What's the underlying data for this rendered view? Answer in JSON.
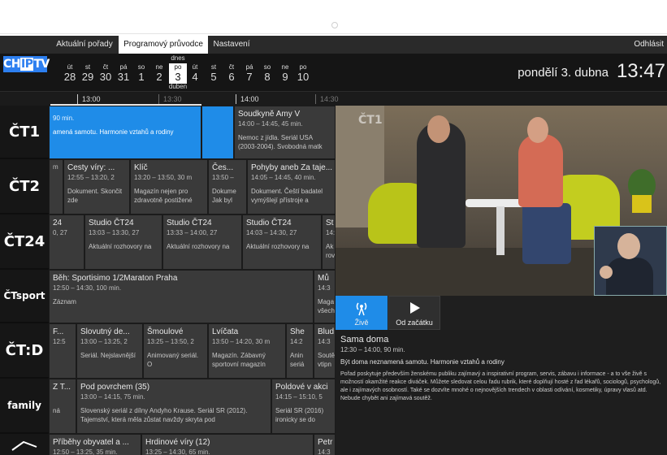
{
  "nav": {
    "tabs": [
      "Aktuální pořady",
      "Programový průvodce",
      "Nastavení"
    ],
    "logout": "Odhlásit"
  },
  "header": {
    "logo": "CHIPTV",
    "today_top": "dnes",
    "today_bottom": "duben",
    "days": [
      {
        "name": "út",
        "num": "28"
      },
      {
        "name": "st",
        "num": "29"
      },
      {
        "name": "čt",
        "num": "30"
      },
      {
        "name": "pá",
        "num": "31"
      },
      {
        "name": "so",
        "num": "1"
      },
      {
        "name": "ne",
        "num": "2"
      },
      {
        "name": "po",
        "num": "3"
      },
      {
        "name": "út",
        "num": "4"
      },
      {
        "name": "st",
        "num": "5"
      },
      {
        "name": "čt",
        "num": "6"
      },
      {
        "name": "pá",
        "num": "7"
      },
      {
        "name": "so",
        "num": "8"
      },
      {
        "name": "ne",
        "num": "9"
      },
      {
        "name": "po",
        "num": "10"
      }
    ],
    "date": "pondělí 3. dubna",
    "time": "13:47"
  },
  "timeline": [
    "13:00",
    "13:30",
    "14:00",
    "14:30"
  ],
  "channels": [
    {
      "name": "ČT1",
      "programs": [
        {
          "title": "",
          "time": "90 min.",
          "desc": "amená samotu. Harmonie vztahů a rodiny"
        },
        {
          "title": "",
          "time": "",
          "desc": ""
        },
        {
          "title": "Soudkyně Amy V",
          "time": "14:00 – 14:45, 45 min.",
          "desc": "Nemoc z jídla. Seriál USA (2003-2004). Svobodná matk"
        }
      ]
    },
    {
      "name": "ČT2",
      "programs": [
        {
          "title": "",
          "time": "m",
          "desc": ""
        },
        {
          "title": "Cesty víry: ...",
          "time": "12:55 – 13:20, 2",
          "desc": "Dokument. Skončit zde"
        },
        {
          "title": "Klíč",
          "time": "13:20 – 13:50, 30 m",
          "desc": "Magazín nejen pro zdravotně postižené"
        },
        {
          "title": "Čes...",
          "time": "13:50 –",
          "desc": "Dokume Jak byl"
        },
        {
          "title": "Pohyby aneb Za taje...",
          "time": "14:05 – 14:45, 40 min.",
          "desc": "Dokument. Čeští badatel vymýšlejí přístroje a"
        }
      ]
    },
    {
      "name": "ČT24",
      "programs": [
        {
          "title": "24",
          "time": "0, 27",
          "desc": ""
        },
        {
          "title": "Studio ČT24",
          "time": "13:03 – 13:30, 27",
          "desc": "Aktuální rozhovory na"
        },
        {
          "title": "Studio ČT24",
          "time": "13:33 – 14:00, 27",
          "desc": "Aktuální rozhovory na"
        },
        {
          "title": "Studio ČT24",
          "time": "14:03 – 14:30, 27",
          "desc": "Aktuální rozhovory na"
        },
        {
          "title": "St",
          "time": "14:",
          "desc": "Ak rov"
        }
      ]
    },
    {
      "name": "ČTsport",
      "programs": [
        {
          "title": "Běh: Sportisimo 1/2Maraton Praha",
          "time": "12:50 – 14:30, 100 min.",
          "desc": "Záznam"
        },
        {
          "title": "Mů",
          "time": "14:3",
          "desc": "Maga všech"
        }
      ]
    },
    {
      "name": "ČT:D",
      "programs": [
        {
          "title": "F...",
          "time": "12:5",
          "desc": ""
        },
        {
          "title": "Slovutný de...",
          "time": "13:00 – 13:25, 2",
          "desc": "Seriál. Nejslavnější"
        },
        {
          "title": "Šmoulové",
          "time": "13:25 – 13:50, 2",
          "desc": "Animovaný seriál. O"
        },
        {
          "title": "Lvíčata",
          "time": "13:50 – 14:20, 30 m",
          "desc": "Magazín. Zábavný sportovní magazín"
        },
        {
          "title": "She",
          "time": "14:2",
          "desc": "Anin seriá"
        },
        {
          "title": "Blud",
          "time": "14:3",
          "desc": "Soutě vtipn"
        }
      ]
    },
    {
      "name": "family",
      "programs": [
        {
          "title": "Z T...",
          "time": "",
          "desc": "ná"
        },
        {
          "title": "Pod povrchem (35)",
          "time": "13:00 – 14:15, 75 min.",
          "desc": "Slovenský seriál z dílny Andyho Krause. Seriál SR (2012). Tajemství, která měla zůstat navždy skryta pod"
        },
        {
          "title": "Poldové v akci",
          "time": "14:15 – 15:10, 5",
          "desc": "Seriál SR (2016) ironicky se do"
        }
      ]
    },
    {
      "name": "",
      "programs": [
        {
          "title": "Příběhy obyvatel a ...",
          "time": "12:50 – 13:25, 35 min.",
          "desc": ""
        },
        {
          "title": "Hrdinové víry (12)",
          "time": "13:25 – 14:30, 65 min.",
          "desc": ""
        },
        {
          "title": "Petr",
          "time": "14:3",
          "desc": ""
        }
      ]
    }
  ],
  "player": {
    "watermark": "ČT1",
    "live_label": "Živě",
    "restart_label": "Od začátku"
  },
  "detail": {
    "title": "Sama doma",
    "time": "12:30 – 14:00, 90 min.",
    "short": "Být doma neznamená samotu. Harmonie vztahů a rodiny",
    "long": "Pořad poskytuje především ženskému publiku zajímavý a inspirativní program, servis, zábavu i informace - a to vše živě s možností okamžité reakce diváček. Můžete sledovat celou řadu rubrik, které doplňují hosté z řad lékařů, sociologů, psychologů, ale i zajímavých osobností. Také se dozvíte mnohé o nejnovějších trendech v oblasti odívání, kosmetiky, úpravy vlasů atd. Nebude chybět ani zajímavá soutěž."
  },
  "colors": {
    "accent": "#1f8ce8",
    "background": "#1b1b1b",
    "cell": "#3a3a3a"
  }
}
